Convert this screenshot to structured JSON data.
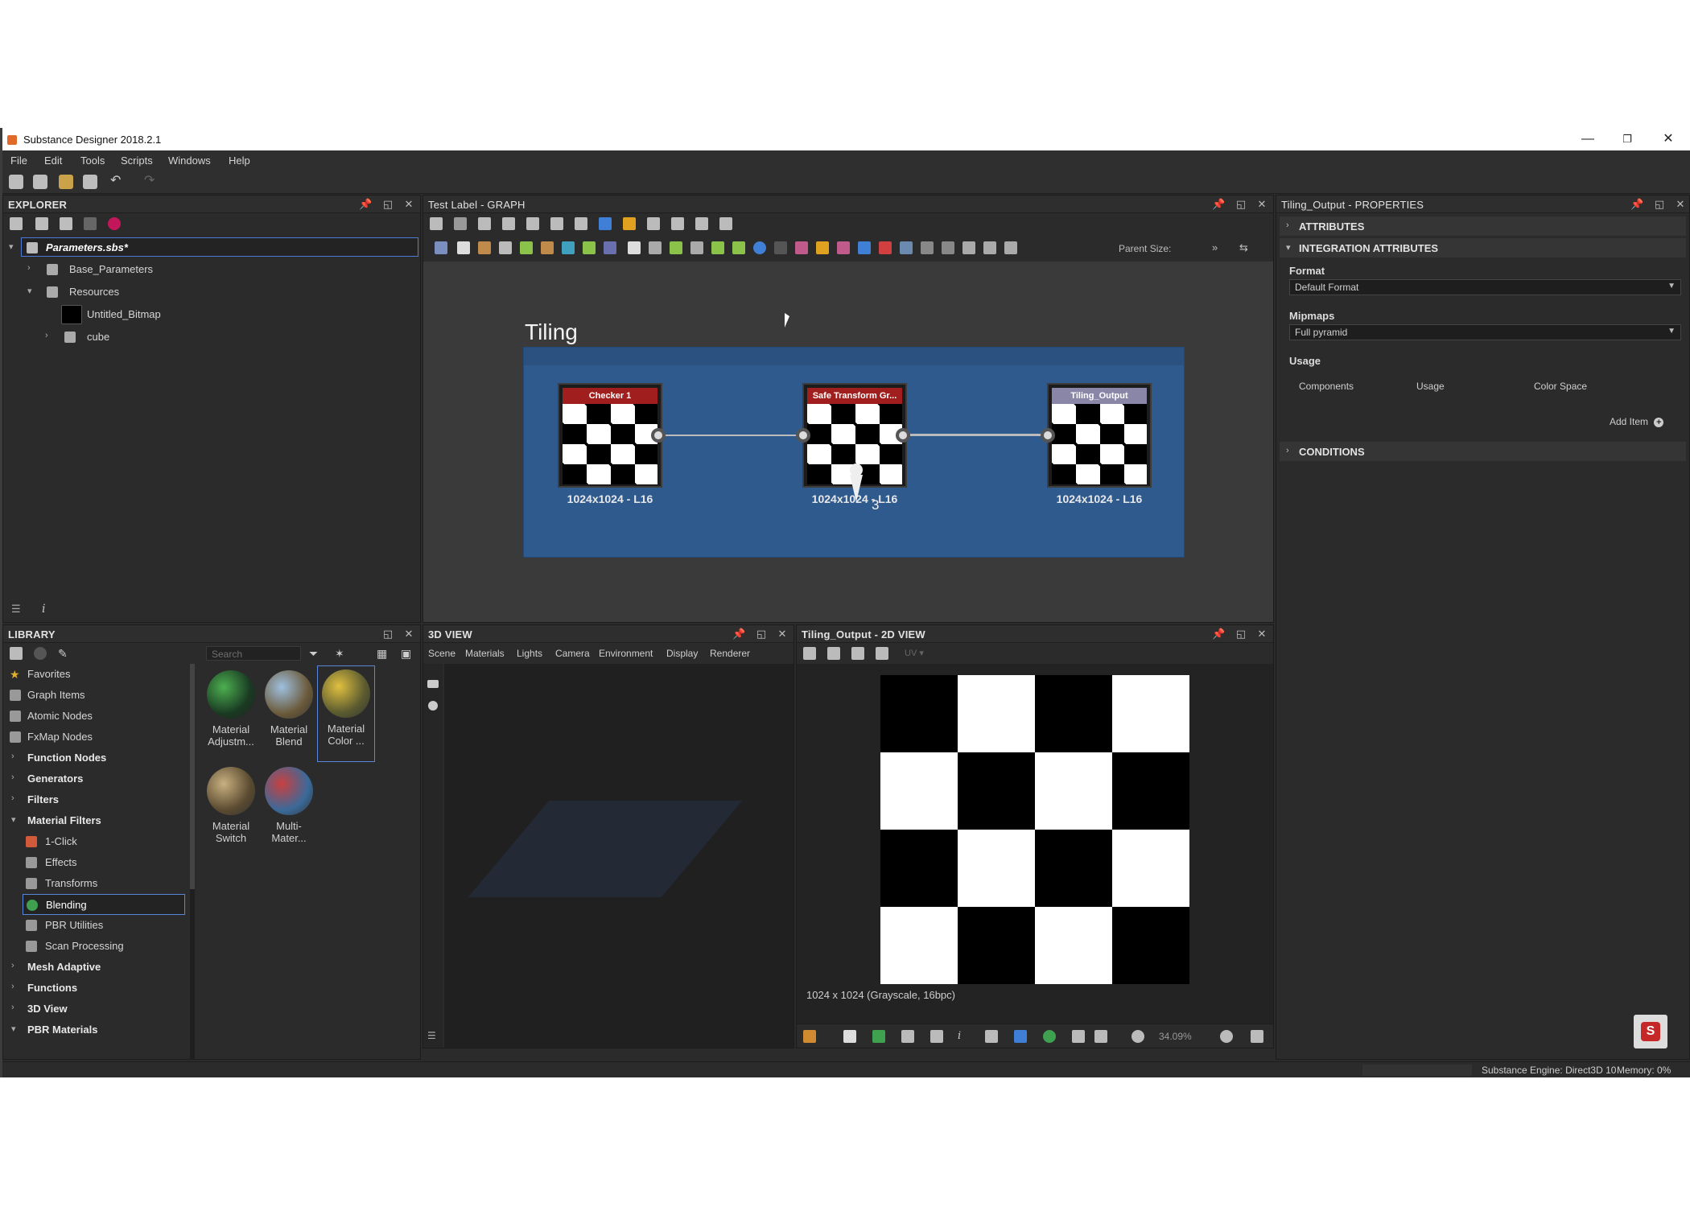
{
  "window": {
    "title": "Substance Designer 2018.2.1",
    "minimize": "—",
    "restore": "❐",
    "close": "✕"
  },
  "menu": [
    "File",
    "Edit",
    "Tools",
    "Scripts",
    "Windows",
    "Help"
  ],
  "explorer": {
    "title": "EXPLORER",
    "items": [
      {
        "label": "Parameters.sbs*",
        "icon": "package-icon"
      },
      {
        "label": "Base_Parameters",
        "icon": "graph-icon"
      },
      {
        "label": "Resources",
        "icon": "folder-icon"
      },
      {
        "label": "Untitled_Bitmap",
        "icon": "bitmap-icon"
      },
      {
        "label": "cube",
        "icon": "mesh-icon"
      }
    ]
  },
  "graph": {
    "title": "Test Label - GRAPH",
    "parent_size_label": "Parent Size:",
    "frame_title": "Tiling",
    "nodes": [
      {
        "title": "Checker 1",
        "res": "1024x1024 - L16",
        "color": "#a01e1e"
      },
      {
        "title": "Safe Transform Gr...",
        "res": "1024x1024 - L16",
        "color": "#a01e1e"
      },
      {
        "title": "Tiling_Output",
        "res": "1024x1024 - L16",
        "color": "#8a86a8"
      }
    ],
    "pin_number": "3"
  },
  "properties": {
    "title": "Tiling_Output - PROPERTIES",
    "sections": {
      "attributes": "ATTRIBUTES",
      "integration": "INTEGRATION ATTRIBUTES",
      "conditions": "CONDITIONS"
    },
    "format_label": "Format",
    "format_value": "Default Format",
    "mipmaps_label": "Mipmaps",
    "mipmaps_value": "Full pyramid",
    "usage_label": "Usage",
    "usage_columns": [
      "Components",
      "Usage",
      "Color Space"
    ],
    "add_item": "Add Item"
  },
  "library": {
    "title": "LIBRARY",
    "search_placeholder": "Search",
    "categories": [
      {
        "label": "Favorites",
        "type": "top"
      },
      {
        "label": "Graph Items",
        "type": "top"
      },
      {
        "label": "Atomic Nodes",
        "type": "top"
      },
      {
        "label": "FxMap Nodes",
        "type": "top"
      },
      {
        "label": "Function Nodes",
        "type": "group"
      },
      {
        "label": "Generators",
        "type": "group"
      },
      {
        "label": "Filters",
        "type": "group"
      },
      {
        "label": "Material Filters",
        "type": "group-open"
      },
      {
        "label": "1-Click",
        "type": "sub"
      },
      {
        "label": "Effects",
        "type": "sub"
      },
      {
        "label": "Transforms",
        "type": "sub"
      },
      {
        "label": "Blending",
        "type": "sub-selected"
      },
      {
        "label": "PBR Utilities",
        "type": "sub"
      },
      {
        "label": "Scan Processing",
        "type": "sub"
      },
      {
        "label": "Mesh Adaptive",
        "type": "group"
      },
      {
        "label": "Functions",
        "type": "group"
      },
      {
        "label": "3D View",
        "type": "group"
      },
      {
        "label": "PBR Materials",
        "type": "group-open"
      }
    ],
    "thumbs": [
      {
        "line1": "Material",
        "line2": "Adjustm..."
      },
      {
        "line1": "Material",
        "line2": "Blend"
      },
      {
        "line1": "Material",
        "line2": "Color ..."
      },
      {
        "line1": "Material",
        "line2": "Switch"
      },
      {
        "line1": "Multi-",
        "line2": "Mater..."
      }
    ]
  },
  "view3d": {
    "title": "3D VIEW",
    "menu": [
      "Scene",
      "Materials",
      "Lights",
      "Camera",
      "Environment",
      "Display",
      "Renderer"
    ]
  },
  "view2d": {
    "title": "Tiling_Output - 2D VIEW",
    "uv_label": "UV",
    "info": "1024 x 1024 (Grayscale, 16bpc)",
    "zoom": "34.09%"
  },
  "status": {
    "engine": "Substance Engine: Direct3D 10",
    "memory": "Memory: 0%"
  }
}
